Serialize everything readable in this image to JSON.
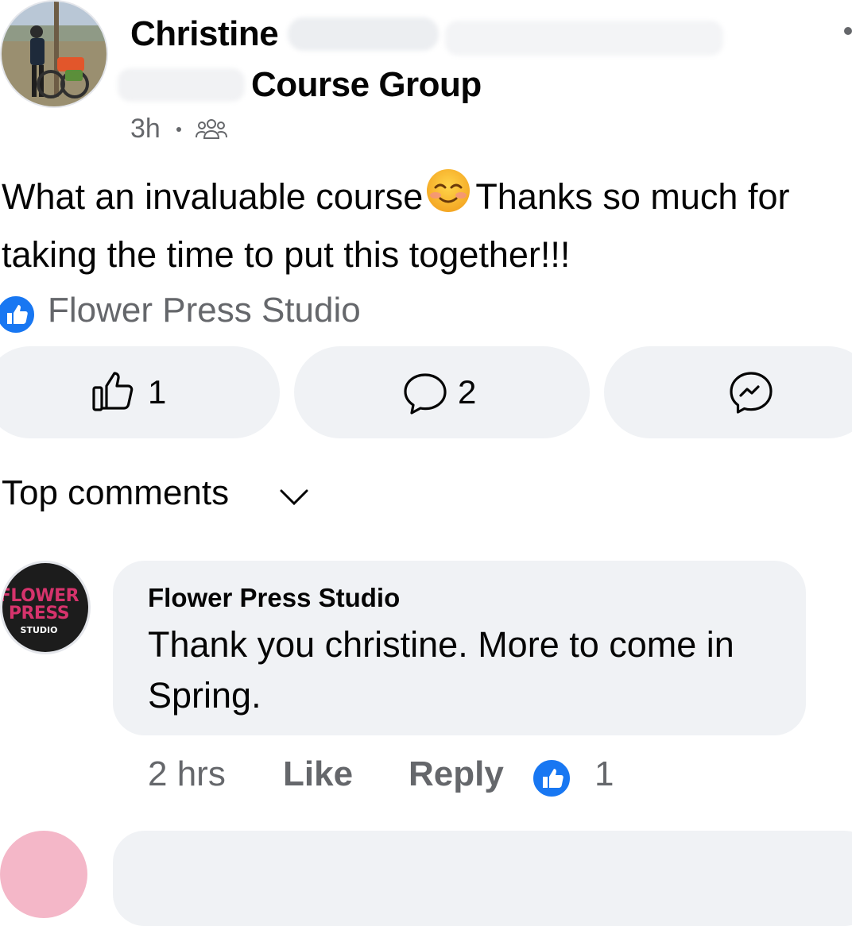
{
  "post": {
    "author_name": "Christine",
    "group_name": "Course Group",
    "time": "3h",
    "text_line1": "What an invaluable course",
    "text_line1b": "Thanks so much for",
    "text_line2": "taking the time to put this together!!!",
    "reaction_by": "Flower Press Studio",
    "like_count": "1",
    "comment_count": "2"
  },
  "comments": {
    "sort_label": "Top comments",
    "items": [
      {
        "author": "Flower Press Studio",
        "text": "Thank you christine. More to come in Spring.",
        "time": "2 hrs",
        "like_label": "Like",
        "reply_label": "Reply",
        "reaction_count": "1",
        "avatar_text": [
          "FLOWER",
          "PRESS",
          "STUDIO"
        ]
      }
    ]
  },
  "colors": {
    "facebook_blue": "#1877f2",
    "pill_bg": "#f0f2f5",
    "secondary_text": "#65676b",
    "brand_pink": "#d6336c"
  },
  "icons": {
    "post_audience": "group-icon",
    "like": "thumbs-up-icon",
    "comment": "comment-bubble-icon",
    "share": "messenger-icon",
    "reaction_badge": "like-reaction-icon",
    "sort": "chevron-down-icon"
  }
}
